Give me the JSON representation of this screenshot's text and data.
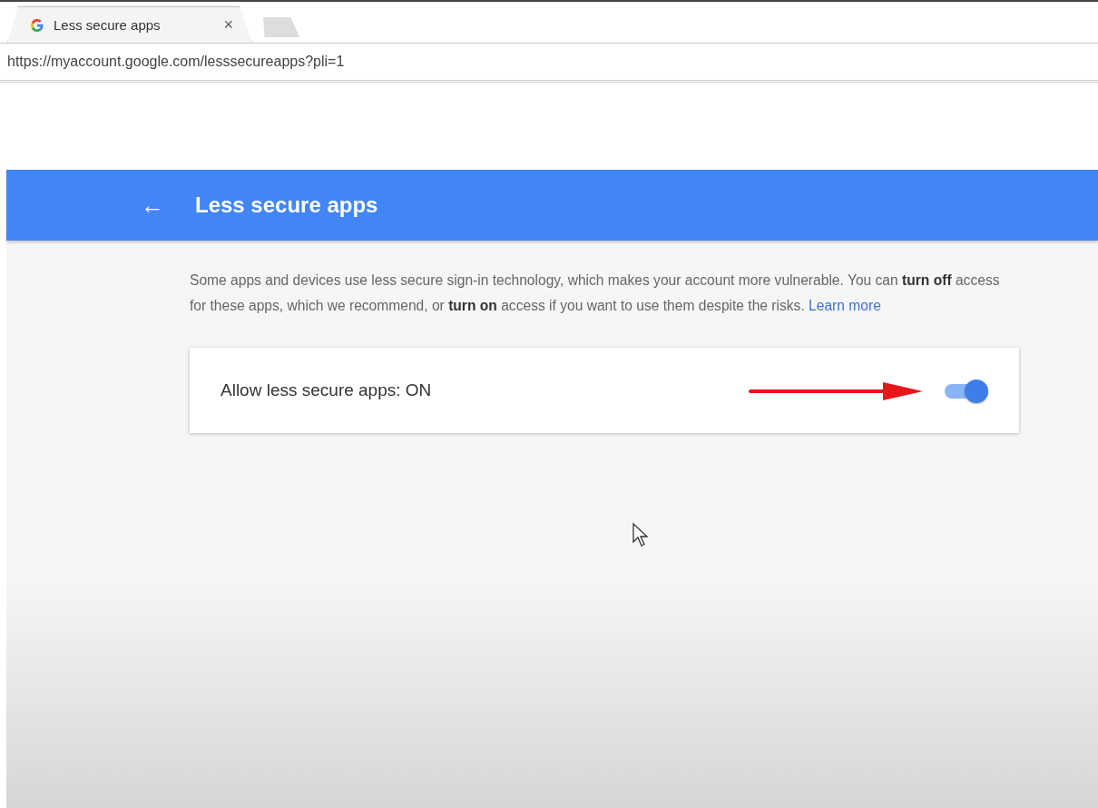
{
  "browser": {
    "tab": {
      "title": "Less secure apps",
      "close": "×"
    },
    "address": "https://myaccount.google.com/lesssecureapps?pli=1"
  },
  "header": {
    "back": "←",
    "title": "Less secure apps"
  },
  "intro": {
    "text": "Some apps and devices use less secure sign-in technology, which makes your account more vulnerable. You can **turn off** access for these apps, which we recommend, or **turn on** access if you want to use them despite the risks.",
    "link": "Learn more"
  },
  "setting": {
    "label": "Allow less secure apps: ON",
    "on": true
  }
}
